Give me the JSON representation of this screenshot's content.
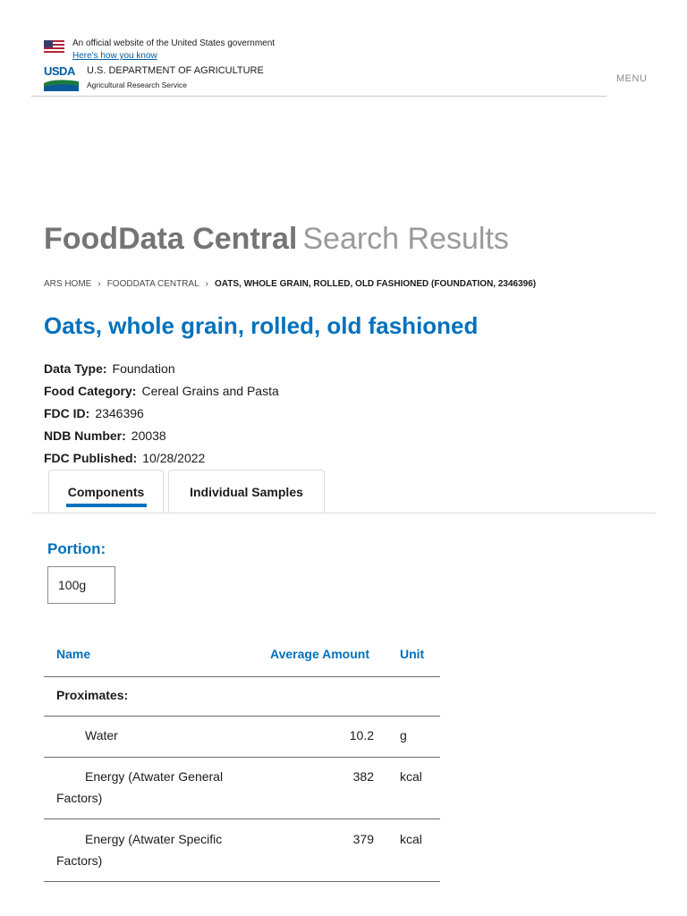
{
  "banner": {
    "official_text": "An official website of the United States government",
    "how_you_know": "Here's how you know"
  },
  "agency": {
    "logo_text": "USDA",
    "department": "U.S. DEPARTMENT OF AGRICULTURE",
    "service": "Agricultural Research Service"
  },
  "nav": {
    "menu_label": "MENU"
  },
  "title": {
    "main": "FoodData Central",
    "sub": "Search Results"
  },
  "breadcrumb": {
    "items": [
      "ARS HOME",
      "FOODDATA CENTRAL"
    ],
    "separator": "›",
    "current": "OATS, WHOLE GRAIN, ROLLED, OLD FASHIONED (FOUNDATION, 2346396)"
  },
  "food": {
    "name": "Oats, whole grain, rolled, old fashioned",
    "details": [
      {
        "label": "Data Type:",
        "value": "Foundation"
      },
      {
        "label": "Food Category:",
        "value": "Cereal Grains and Pasta"
      },
      {
        "label": "FDC ID:",
        "value": "2346396"
      },
      {
        "label": "NDB Number:",
        "value": "20038"
      },
      {
        "label": "FDC Published:",
        "value": "10/28/2022"
      }
    ]
  },
  "tabs": [
    {
      "label": "Components",
      "active": true
    },
    {
      "label": "Individual Samples",
      "active": false
    }
  ],
  "portion": {
    "label": "Portion:",
    "value": "100g"
  },
  "table": {
    "headers": {
      "name": "Name",
      "amount": "Average Amount",
      "unit": "Unit"
    },
    "group": "Proximates:",
    "rows": [
      {
        "name_line1": "Water",
        "name_line2": "",
        "amount": "10.2",
        "unit": "g"
      },
      {
        "name_line1": "Energy (Atwater General",
        "name_line2": "Factors)",
        "amount": "382",
        "unit": "kcal"
      },
      {
        "name_line1": "Energy (Atwater Specific",
        "name_line2": "Factors)",
        "amount": "379",
        "unit": "kcal"
      }
    ]
  },
  "colors": {
    "accent": "#0071bc",
    "title_gray": "#757575",
    "text": "#1b1b1b"
  }
}
